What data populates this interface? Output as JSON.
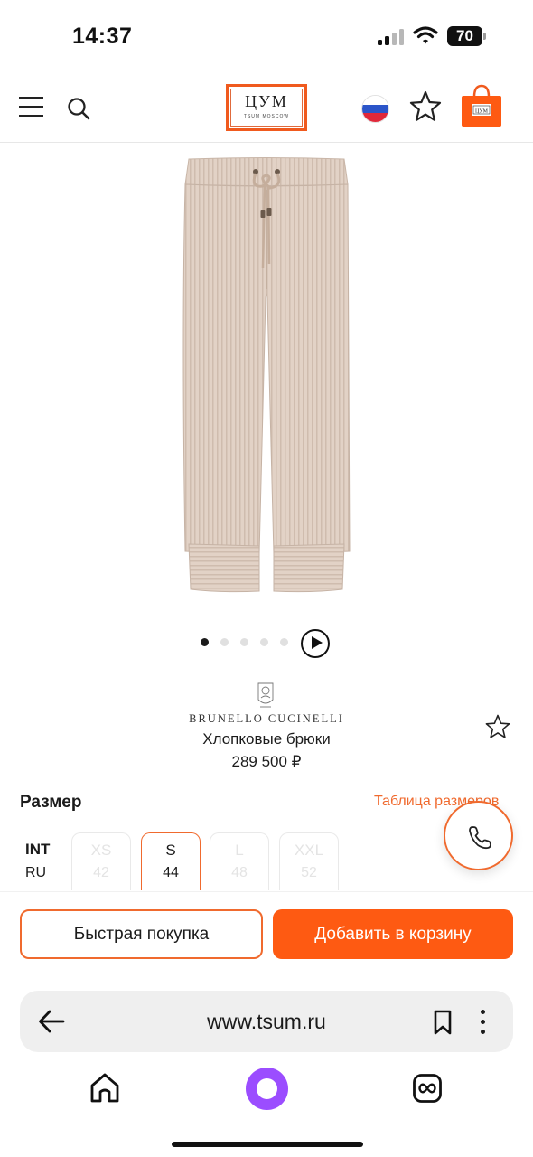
{
  "status_bar": {
    "time": "14:37",
    "battery": "70"
  },
  "header": {
    "logo_text": "ЦУМ",
    "logo_subtext": "TSUM MOSCOW",
    "icons": [
      "menu-icon",
      "search-icon",
      "russia-flag-icon",
      "star-icon",
      "shopping-bag-icon"
    ]
  },
  "gallery": {
    "slides": 5,
    "active_slide": 1
  },
  "product": {
    "brand": "BRUNELLO CUCINELLI",
    "title": "Хлопковые брюки",
    "price": "289 500 ₽"
  },
  "size_section": {
    "title": "Размер",
    "table_link": "Таблица размеров",
    "label_int": "INT",
    "label_ru": "RU",
    "options": [
      {
        "int": "XS",
        "ru": "42",
        "available": false
      },
      {
        "int": "S",
        "ru": "44",
        "available": true,
        "selected": true
      },
      {
        "int": "L",
        "ru": "48",
        "available": false
      },
      {
        "int": "XXL",
        "ru": "52",
        "available": false
      }
    ]
  },
  "actions": {
    "buy_now": "Быстрая покупка",
    "add_to_cart": "Добавить в корзину"
  },
  "browser": {
    "url": "www.tsum.ru"
  },
  "colors": {
    "accent": "#f06a2e",
    "primary_button": "#fe5a12",
    "alice": "#9b4dff",
    "product_fabric": "#e2d1c5"
  }
}
